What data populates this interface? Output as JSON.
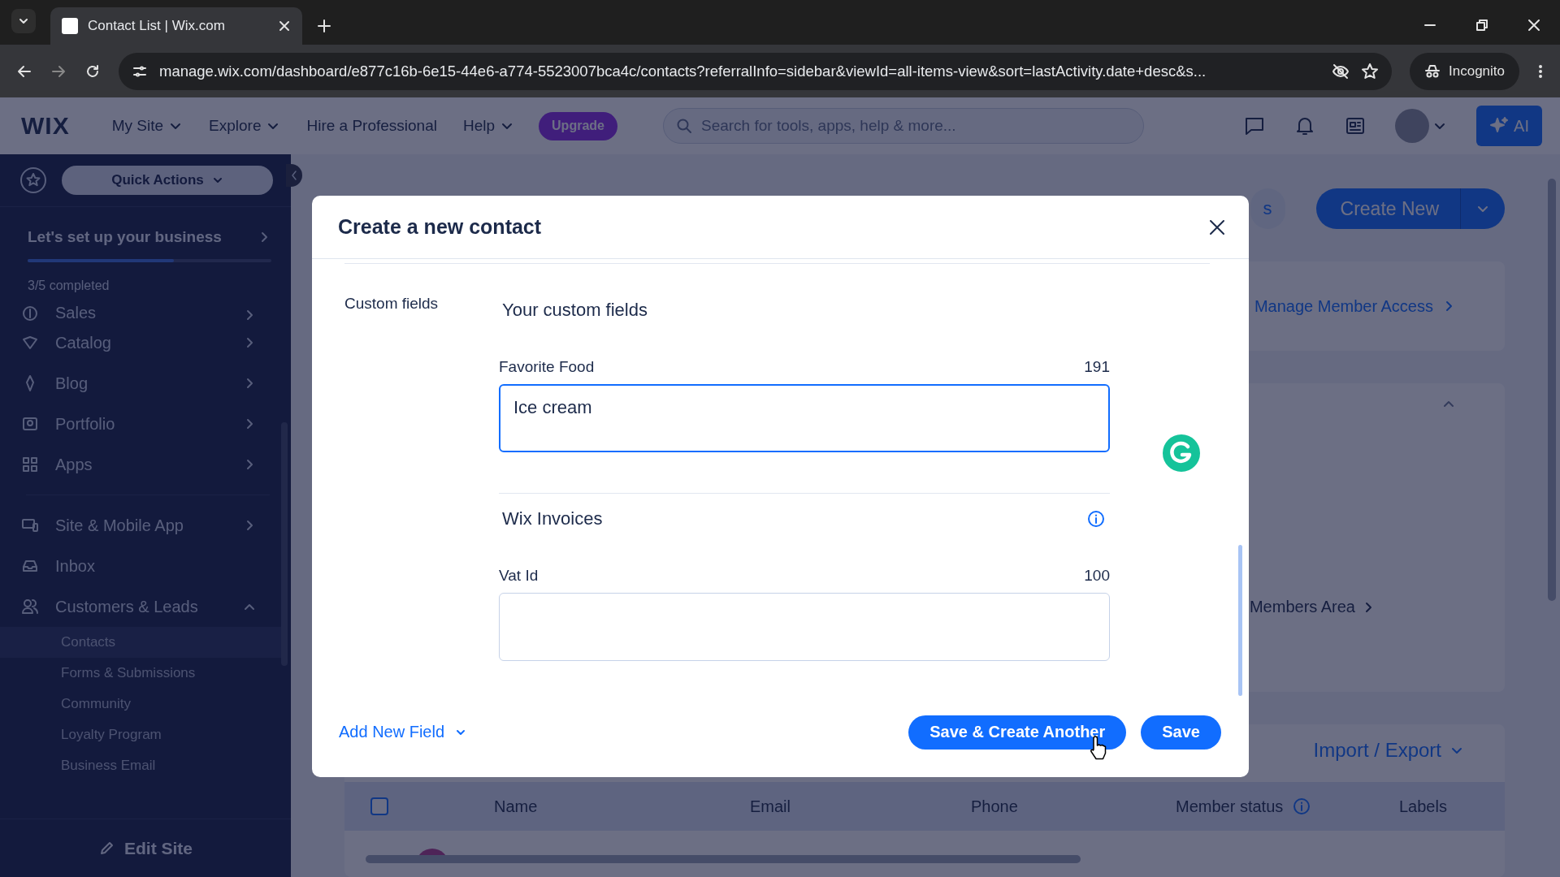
{
  "browser": {
    "tab_title": "Contact List | Wix.com",
    "url": "manage.wix.com/dashboard/e877c16b-6e15-44e6-a774-5523007bca4c/contacts?referralInfo=sidebar&viewId=all-items-view&sort=lastActivity.date+desc&s...",
    "incognito_label": "Incognito"
  },
  "header": {
    "logo": "WIX",
    "nav": [
      {
        "label": "My Site",
        "dropdown": true
      },
      {
        "label": "Explore",
        "dropdown": true
      },
      {
        "label": "Hire a Professional",
        "dropdown": false
      },
      {
        "label": "Help",
        "dropdown": true
      }
    ],
    "upgrade": "Upgrade",
    "search": {
      "placeholder": "Search for tools, apps, help & more..."
    },
    "ai_label": "AI"
  },
  "sidebar": {
    "quick_actions": "Quick Actions",
    "setup": {
      "title": "Let's set up your business",
      "level": 0.6,
      "progress_text": "3/5 completed"
    },
    "items": [
      {
        "label": "Sales",
        "has_submenu": true
      },
      {
        "label": "Catalog",
        "has_submenu": true
      },
      {
        "label": "Blog",
        "has_submenu": true
      },
      {
        "label": "Portfolio",
        "has_submenu": true
      },
      {
        "label": "Apps",
        "has_submenu": true
      },
      {
        "label": "Site & Mobile App",
        "has_submenu": true,
        "divider_before": true
      },
      {
        "label": "Inbox",
        "has_submenu": false
      },
      {
        "label": "Customers & Leads",
        "has_submenu": true,
        "expanded": true,
        "children": [
          {
            "label": "Contacts",
            "selected": true
          },
          {
            "label": "Forms & Submissions",
            "selected": false
          },
          {
            "label": "Community",
            "selected": false
          },
          {
            "label": "Loyalty Program",
            "selected": false
          },
          {
            "label": "Business Email",
            "selected": false
          }
        ]
      }
    ],
    "edit_site": "Edit Site"
  },
  "page": {
    "partial_button": "s",
    "create_new": "Create New",
    "manage_member_access": "Manage Member Access",
    "members_area": "Members Area",
    "import_export": "Import / Export",
    "table": {
      "select_all_checked": false,
      "columns": [
        {
          "label": "Name"
        },
        {
          "label": "Email"
        },
        {
          "label": "Phone"
        },
        {
          "label": "Member status",
          "info": true
        },
        {
          "label": "Labels"
        }
      ]
    }
  },
  "modal": {
    "title": "Create a new contact",
    "section_label": "Custom fields",
    "groups": [
      {
        "title": "Your custom fields",
        "fields": [
          {
            "label": "Favorite Food",
            "counter": "191",
            "value": "Ice cream",
            "focused": true
          }
        ]
      },
      {
        "title": "Wix Invoices",
        "info": true,
        "fields": [
          {
            "label": "Vat Id",
            "counter": "100",
            "focused": false
          }
        ]
      }
    ],
    "add_field": "Add New Field",
    "buttons": [
      {
        "label": "Save & Create Another",
        "kind": "primary"
      },
      {
        "label": "Save",
        "kind": "primary"
      }
    ]
  }
}
